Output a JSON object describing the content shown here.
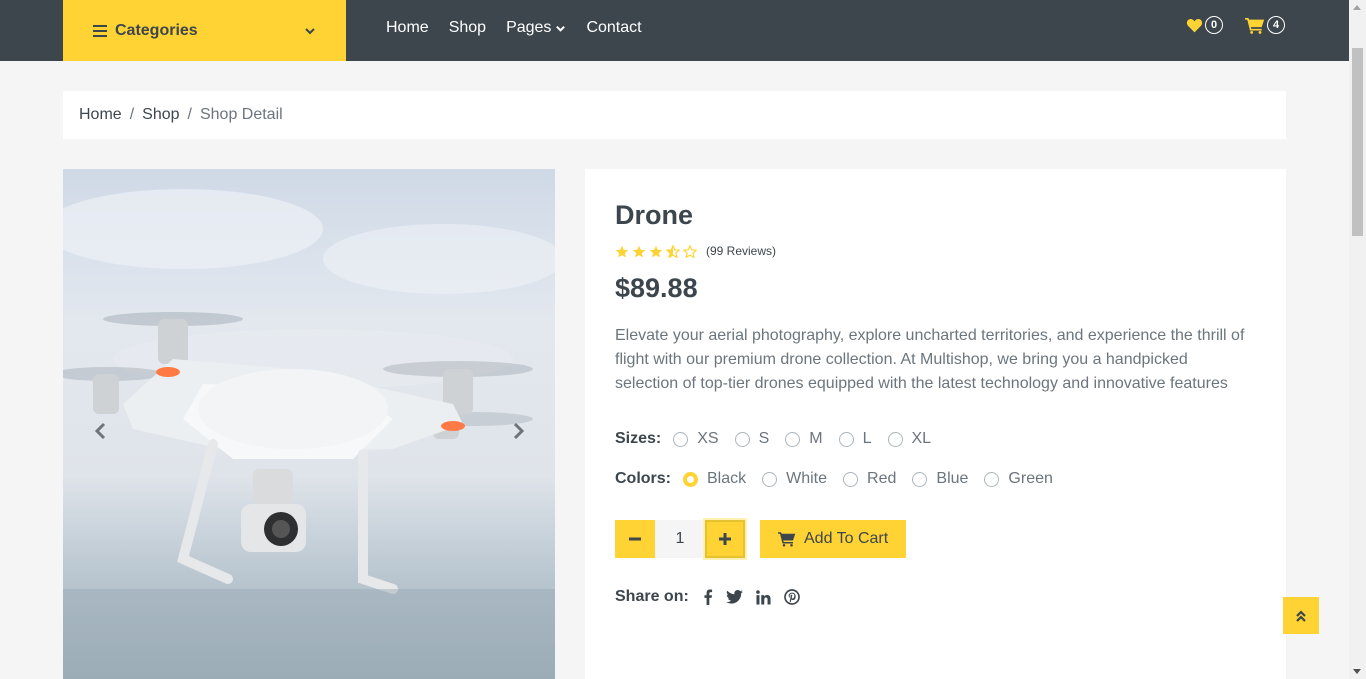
{
  "navbar": {
    "categories_label": "Categories",
    "links": [
      "Home",
      "Shop",
      "Pages",
      "Contact"
    ],
    "wishlist_count": "0",
    "cart_count": "4"
  },
  "breadcrumb": {
    "items": [
      "Home",
      "Shop"
    ],
    "current": "Shop Detail",
    "separator": "/"
  },
  "product": {
    "title": "Drone",
    "rating": 3.5,
    "reviews": "(99 Reviews)",
    "price": "$89.88",
    "description": "Elevate your aerial photography, explore uncharted territories, and experience the thrill of flight with our premium drone collection. At Multishop, we bring you a handpicked selection of top-tier drones equipped with the latest technology and innovative features",
    "sizes_label": "Sizes:",
    "sizes": [
      "XS",
      "S",
      "M",
      "L",
      "XL"
    ],
    "colors_label": "Colors:",
    "colors": [
      "Black",
      "White",
      "Red",
      "Blue",
      "Green"
    ],
    "selected_color": "Black",
    "quantity": "1",
    "add_to_cart_label": "Add To Cart",
    "share_label": "Share on:",
    "share_icons": [
      "facebook-icon",
      "twitter-icon",
      "linkedin-icon",
      "pinterest-icon"
    ]
  },
  "theme": {
    "accent": "#ffd333",
    "dark": "#3d464d",
    "text": "#6c757d"
  }
}
